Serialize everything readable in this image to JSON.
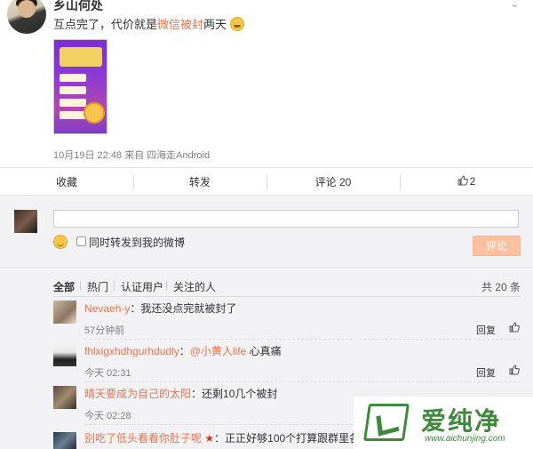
{
  "post": {
    "username": "乡山何处",
    "text_before": "互点完了，代价就是",
    "text_highlight": "微信被封",
    "text_after": "两天",
    "meta": "10月19日 22:48 来自 四海走Android"
  },
  "actions": {
    "favorite": "收藏",
    "repost": "转发",
    "comment": "评论 20",
    "like_count": "2"
  },
  "composer": {
    "input_value": "",
    "repost_label": "同时转发到我的微博",
    "submit_label": "评论"
  },
  "filters": {
    "items": [
      "全部",
      "热门",
      "认证用户",
      "关注的人"
    ],
    "count": "共 20 条"
  },
  "comments": [
    {
      "user": "Nevaeh-y",
      "sep": "：",
      "mention": "",
      "text": "我还没点完就被封了",
      "time": "57分钟前",
      "reply": "回复"
    },
    {
      "user": "fhlxigxhdhgurhdudly",
      "sep": "：",
      "mention": "@小黄人life",
      "text": " 心真痛",
      "time": "今天 02:31",
      "reply": "回复"
    },
    {
      "user": "晴天要成为自己的太阳",
      "sep": "：",
      "mention": "",
      "text": "还剩10几个被封",
      "time": "今天 02:28",
      "reply": "回复"
    },
    {
      "user": "别吃了低头看看你肚子呢",
      "sep": "：",
      "mention": "",
      "text": "正正好够100个打算跟群里各位大佬",
      "time": "",
      "reply": ""
    }
  ],
  "watermark": {
    "title": "爱纯净",
    "url": "www.aichunjing.com"
  }
}
